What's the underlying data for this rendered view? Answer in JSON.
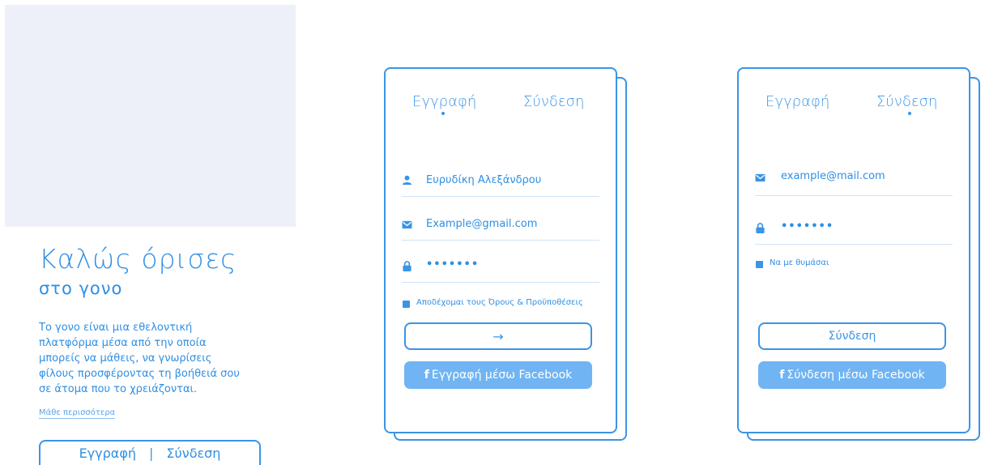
{
  "welcome": {
    "title": "Καλώς όρισες",
    "subtitle": "στο γονο",
    "description": "Το γονο είναι μια εθελοντική πλατφόρμα μέσα από την οποία μπορείς να μάθεις, να γνωρίσεις φίλους προσφέροντας τη βοήθειά σου σε άτομα που το χρειάζονται.",
    "learn_more": "Μάθε περισσότερα",
    "register": "Εγγραφή",
    "separator": "|",
    "login": "Σύνδεση"
  },
  "register_card": {
    "tab_register": "Εγγραφή",
    "tab_login": "Σύνδεση",
    "active_tab": "register",
    "name_value": "Ευρυδίκη Αλεξάνδρου",
    "email_value": "Example@gmail.com",
    "password_value": "•••••••",
    "terms_label": "Αποδέχομαι τους Όρους & Προϋποθέσεις",
    "terms_checked": true,
    "submit_icon": "→",
    "facebook_label": "Εγγραφή μέσω Facebook"
  },
  "login_card": {
    "tab_register": "Εγγραφή",
    "tab_login": "Σύνδεση",
    "active_tab": "login",
    "email_value": "example@mail.com",
    "password_value": "•••••••",
    "remember_label": "Να με θυμάσαι",
    "remember_checked": true,
    "submit_label": "Σύνδεση",
    "facebook_label": "Σύνδεση μέσω Facebook"
  },
  "colors": {
    "accent": "#3b94e6",
    "facebook_button": "#70b4f3",
    "image_placeholder": "#eef0f9"
  }
}
